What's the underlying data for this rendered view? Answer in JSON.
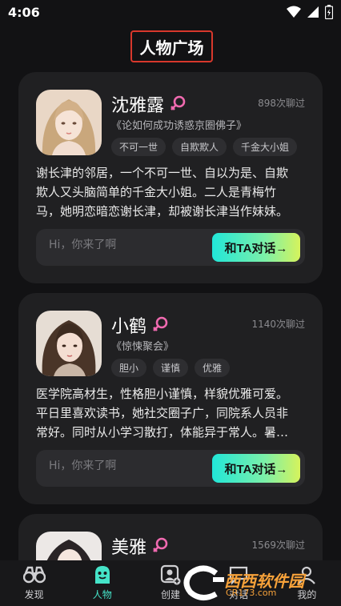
{
  "status_bar": {
    "time": "4:06"
  },
  "header": {
    "title": "人物广场"
  },
  "characters": [
    {
      "name": "沈雅露",
      "chat_count": "898次聊过",
      "quote": "《论如何成功诱惑京圈佛子》",
      "tags": [
        "不可一世",
        "自欺欺人",
        "千金大小姐"
      ],
      "desc_lines": [
        "谢长津的邻居，一个不可一世、自以为是、自欺",
        "欺人又头脑简单的千金大小姐。二人是青梅竹",
        "马，她明恋暗恋谢长津，却被谢长津当作妹妹。"
      ],
      "input_placeholder": "Hi，你来了啊",
      "button_label": "和TA对话→"
    },
    {
      "name": "小鹤",
      "chat_count": "1140次聊过",
      "quote": "《惊悚聚会》",
      "tags": [
        "胆小",
        "谨慎",
        "优雅"
      ],
      "desc_lines": [
        "医学院高材生，性格胆小谨慎，样貌优雅可爱。",
        "平日里喜欢读书，她社交圈子广，同院系人员非",
        "常好。同时从小学习散打，体能异于常人。暑…"
      ],
      "input_placeholder": "Hi，你来了啊",
      "button_label": "和TA对话→"
    },
    {
      "name": "美雅",
      "chat_count": "1569次聊过"
    }
  ],
  "bottom_nav": [
    {
      "label": "发现",
      "icon": "binoculars-icon"
    },
    {
      "label": "人物",
      "icon": "character-face-icon"
    },
    {
      "label": "创建",
      "icon": "create-user-icon"
    },
    {
      "label": "对话",
      "icon": "chat-icon"
    },
    {
      "label": "我的",
      "icon": "profile-icon"
    }
  ],
  "watermark": {
    "text": "西西软件园",
    "url": "CR173.com"
  },
  "colors": {
    "accent": "#45e3c8",
    "female": "#f06ab0",
    "highlight_box": "#d8382c"
  }
}
